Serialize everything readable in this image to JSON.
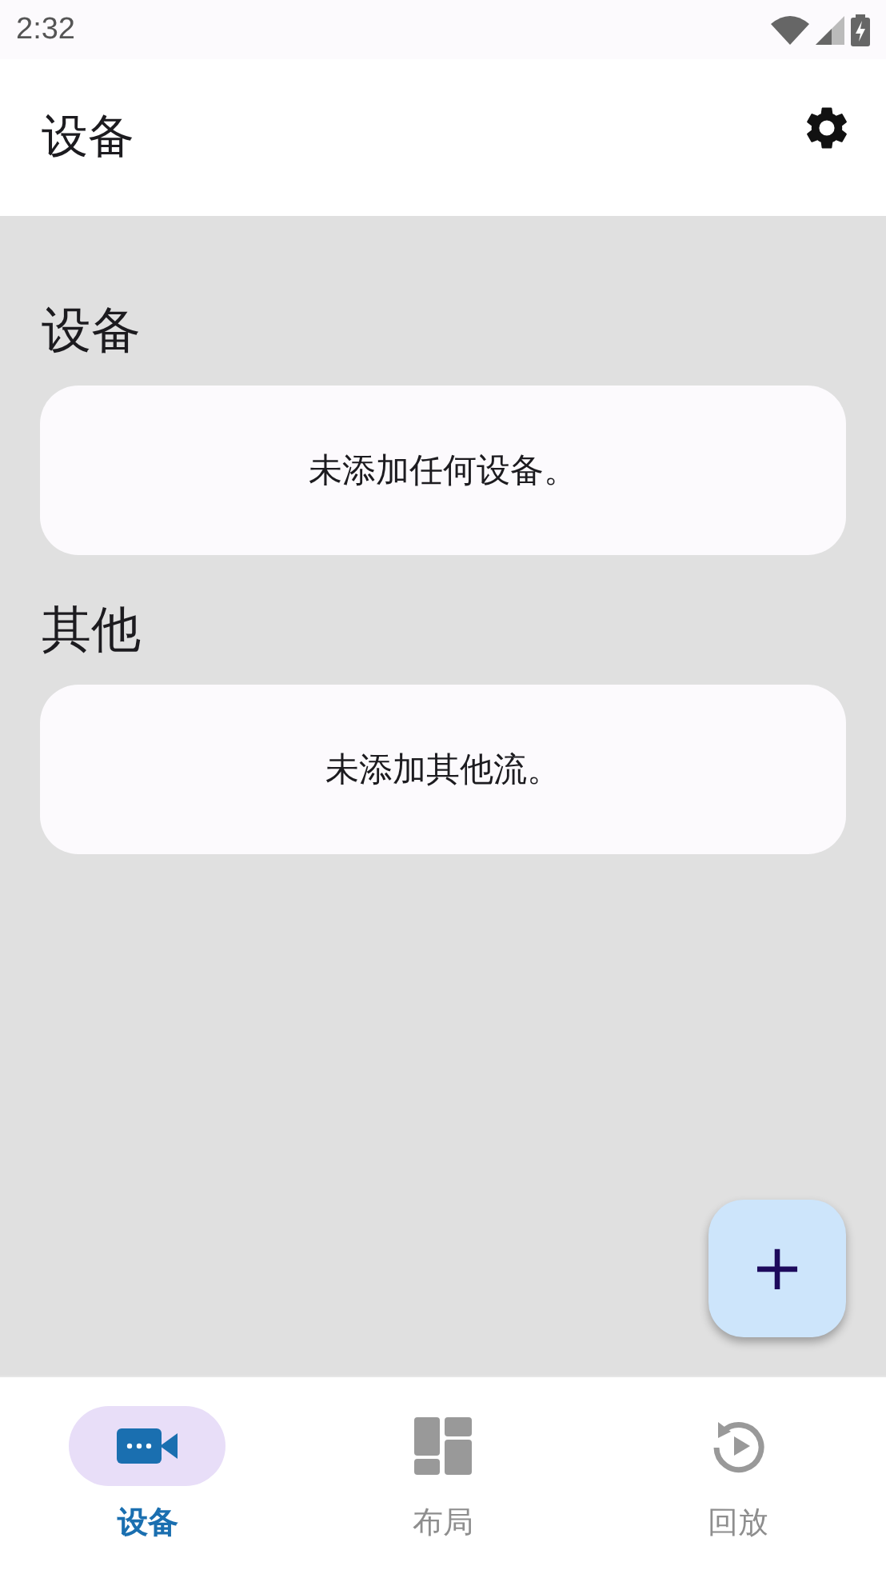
{
  "status_bar": {
    "time": "2:32"
  },
  "app_bar": {
    "title": "设备"
  },
  "sections": [
    {
      "heading": "设备",
      "empty_text": "未添加任何设备。"
    },
    {
      "heading": "其他",
      "empty_text": "未添加其他流。"
    }
  ],
  "fab": {
    "label": "+"
  },
  "bottom_nav": [
    {
      "label": "设备",
      "selected": true
    },
    {
      "label": "布局",
      "selected": false
    },
    {
      "label": "回放",
      "selected": false
    }
  ]
}
